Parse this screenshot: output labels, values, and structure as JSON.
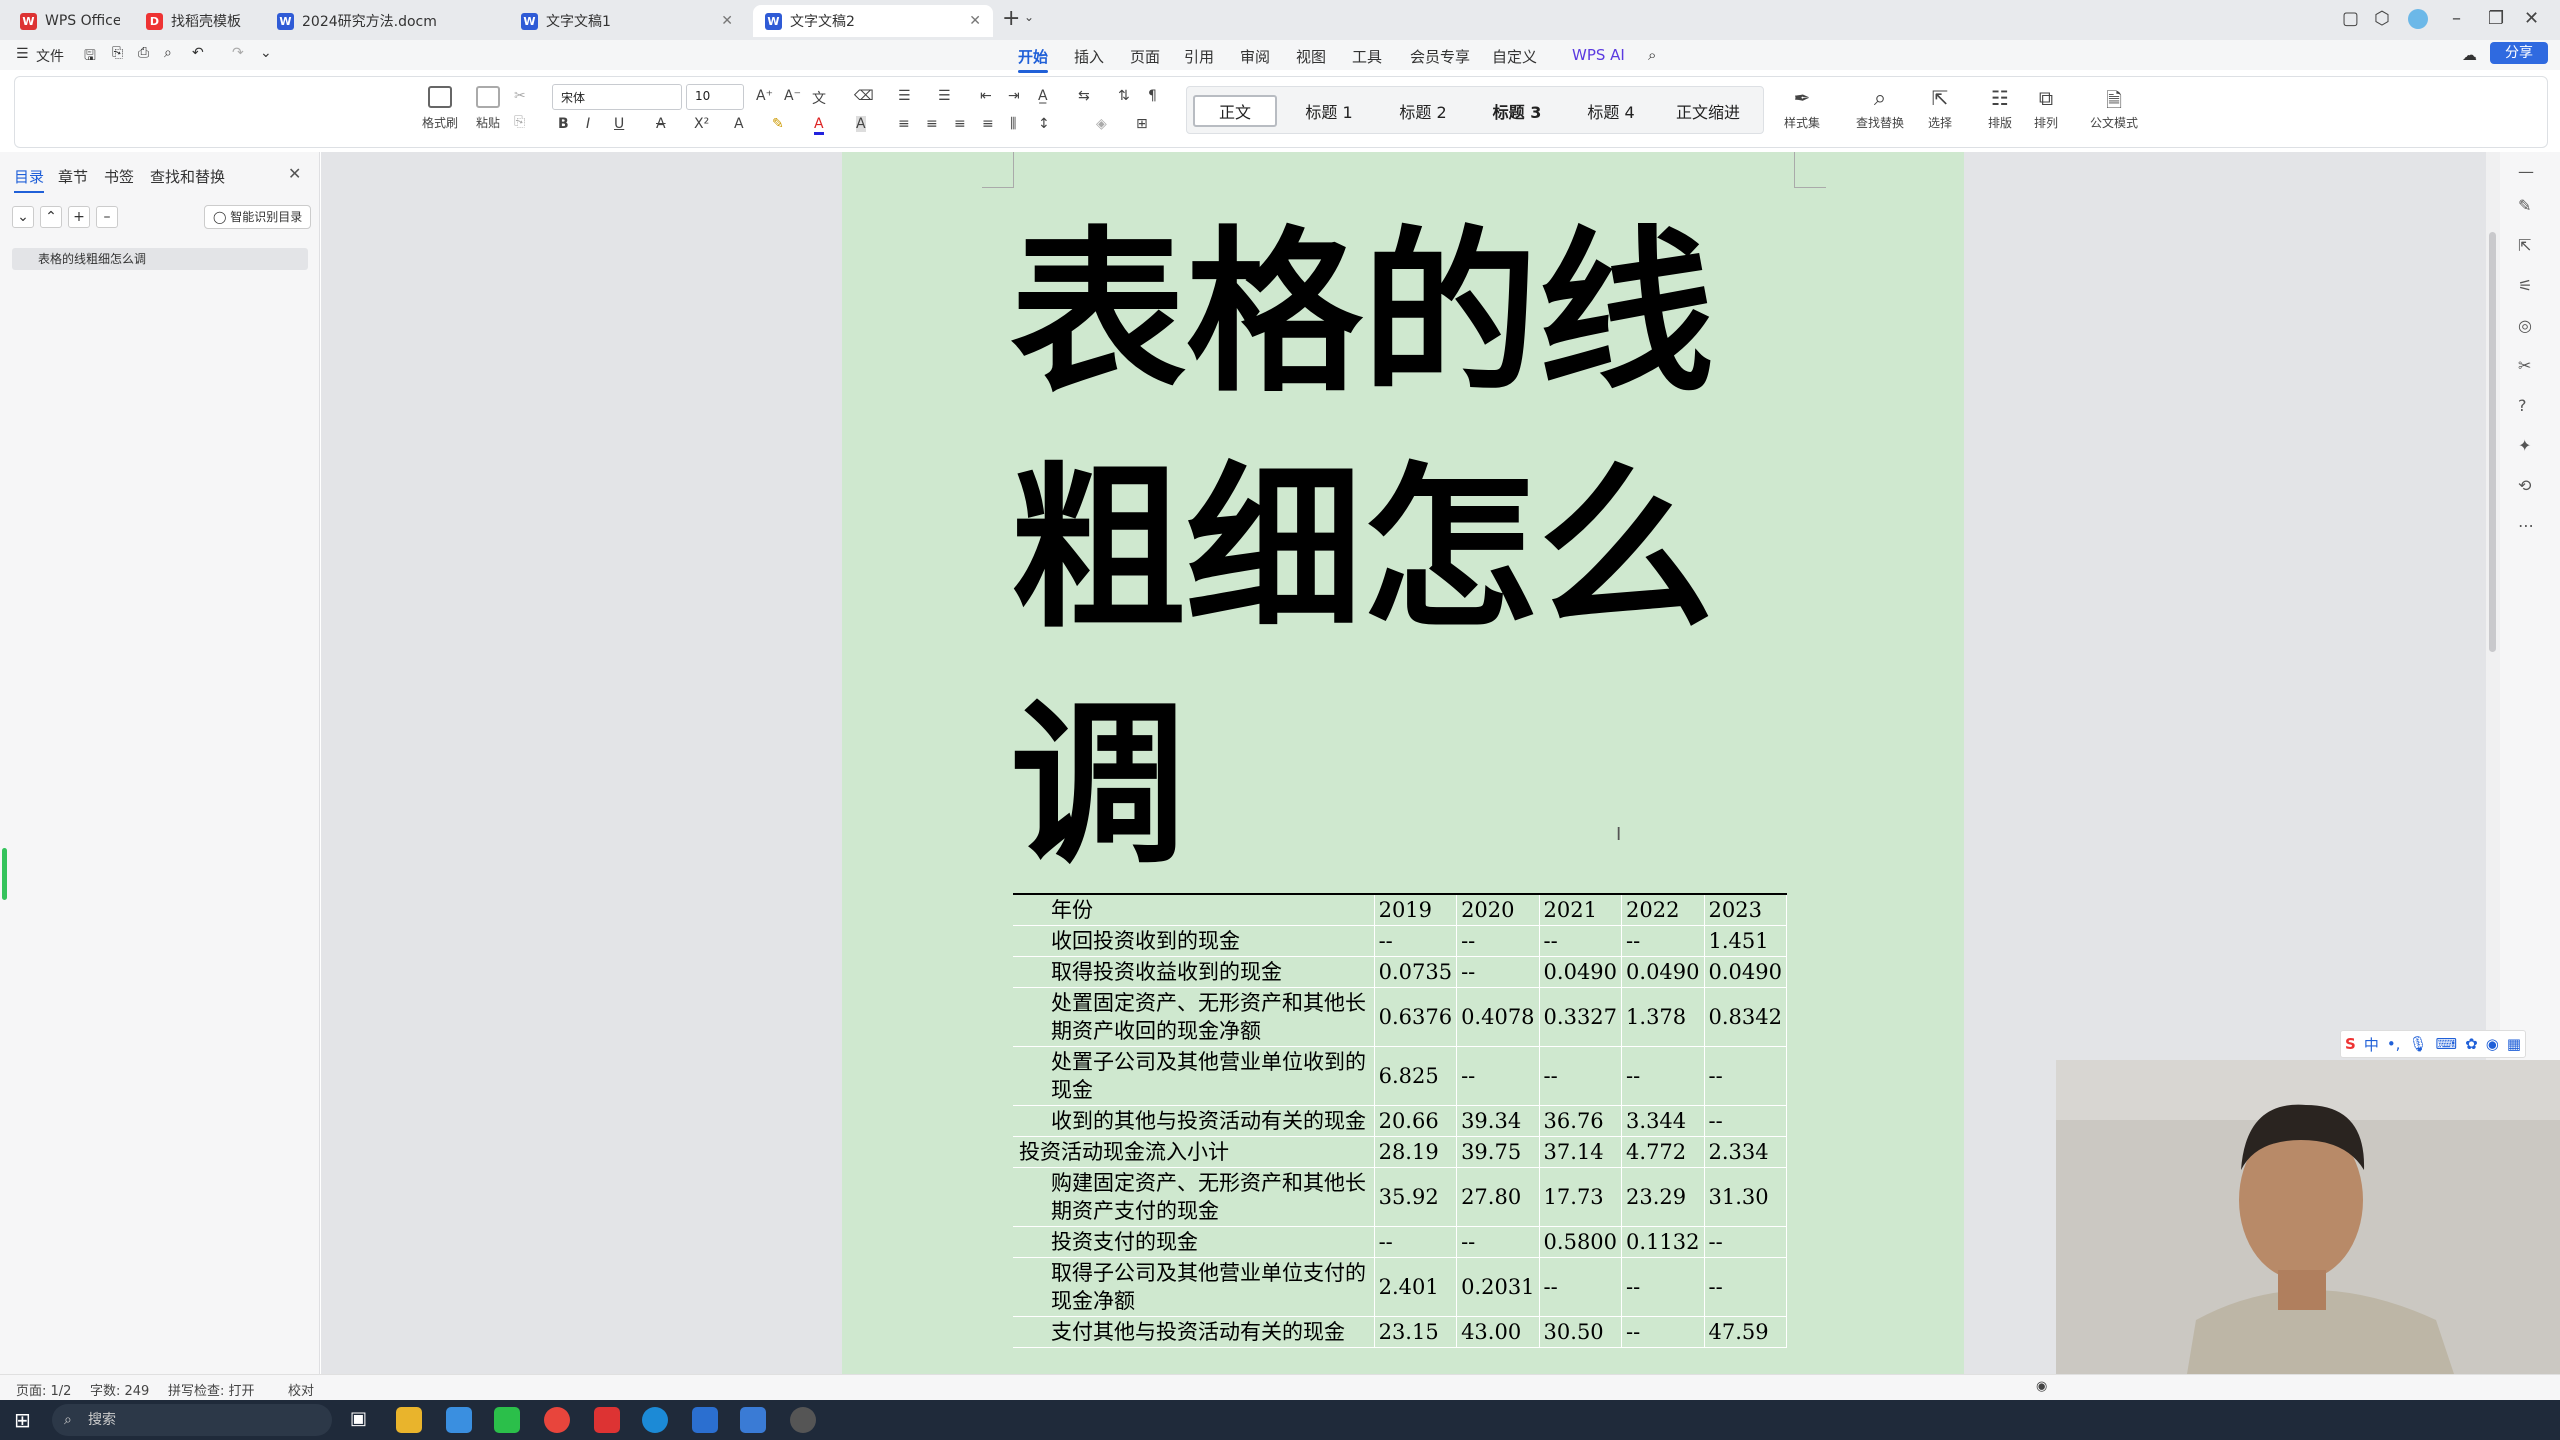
{
  "tabs": [
    {
      "label": "WPS Office",
      "icon": "W",
      "color": "#d33"
    },
    {
      "label": "找稻壳模板",
      "icon": "D",
      "color": "#e33"
    },
    {
      "label": "2024研究方法.docm",
      "icon": "W",
      "color": "#2f5bd6"
    },
    {
      "label": "文字文稿1",
      "icon": "W",
      "color": "#2f5bd6"
    },
    {
      "label": "文字文稿2",
      "icon": "W",
      "color": "#2f5bd6"
    }
  ],
  "toolbar": {
    "file": "文件"
  },
  "menu": [
    "开始",
    "插入",
    "页面",
    "引用",
    "审阅",
    "视图",
    "工具",
    "会员专享",
    "自定义"
  ],
  "wps_ai": "WPS AI",
  "share": "分享",
  "ribbon": {
    "format_painter": "格式刷",
    "paste": "粘贴",
    "font": "宋体",
    "font_size": "10",
    "styles": [
      "正文",
      "标题 1",
      "标题 2",
      "标题 3",
      "标题 4",
      "正文缩进"
    ],
    "style_set": "样式集",
    "find_replace": "查找替换",
    "select": "选择",
    "layout": "排版",
    "arrange": "排列",
    "official": "公文模式"
  },
  "sidebar": {
    "tabs": [
      "目录",
      "章节",
      "书签",
      "查找和替换"
    ],
    "smart_toc": "智能识别目录",
    "toc_item": "表格的线粗细怎么调"
  },
  "document": {
    "title": "表格的线粗细怎么调",
    "table": {
      "header": [
        "年份",
        "2019",
        "2020",
        "2021",
        "2022",
        "2023"
      ],
      "rows": [
        {
          "label": "收回投资收到的现金",
          "vals": [
            "--",
            "--",
            "--",
            "--",
            "1.451"
          ],
          "indent": true
        },
        {
          "label": "取得投资收益收到的现金",
          "vals": [
            "0.0735",
            "--",
            "0.0490",
            "0.0490",
            "0.0490"
          ],
          "indent": true
        },
        {
          "label": "处置固定资产、无形资产和其他长期资产收回的现金净额",
          "vals": [
            "0.6376",
            "0.4078",
            "0.3327",
            "1.378",
            "0.8342"
          ],
          "indent": true
        },
        {
          "label": "处置子公司及其他营业单位收到的现金",
          "vals": [
            "6.825",
            "--",
            "--",
            "--",
            "--"
          ],
          "indent": true
        },
        {
          "label": "收到的其他与投资活动有关的现金",
          "vals": [
            "20.66",
            "39.34",
            "36.76",
            "3.344",
            "--"
          ],
          "indent": true
        },
        {
          "label": "投资活动现金流入小计",
          "vals": [
            "28.19",
            "39.75",
            "37.14",
            "4.772",
            "2.334"
          ],
          "indent": false
        },
        {
          "label": "购建固定资产、无形资产和其他长期资产支付的现金",
          "vals": [
            "35.92",
            "27.80",
            "17.73",
            "23.29",
            "31.30"
          ],
          "indent": true
        },
        {
          "label": "投资支付的现金",
          "vals": [
            "--",
            "--",
            "0.5800",
            "0.1132",
            "--"
          ],
          "indent": true
        },
        {
          "label": "取得子公司及其他营业单位支付的现金净额",
          "vals": [
            "2.401",
            "0.2031",
            "--",
            "--",
            "--"
          ],
          "indent": true
        },
        {
          "label": "支付其他与投资活动有关的现金",
          "vals": [
            "23.15",
            "43.00",
            "30.50",
            "--",
            "47.59"
          ],
          "indent": true
        }
      ]
    }
  },
  "status": {
    "page": "页面: 1/2",
    "words": "字数: 249",
    "spell": "拼写检查: 打开",
    "proof": "校对"
  },
  "taskbar": {
    "search": "搜索"
  },
  "ime": {
    "lang": "中"
  }
}
